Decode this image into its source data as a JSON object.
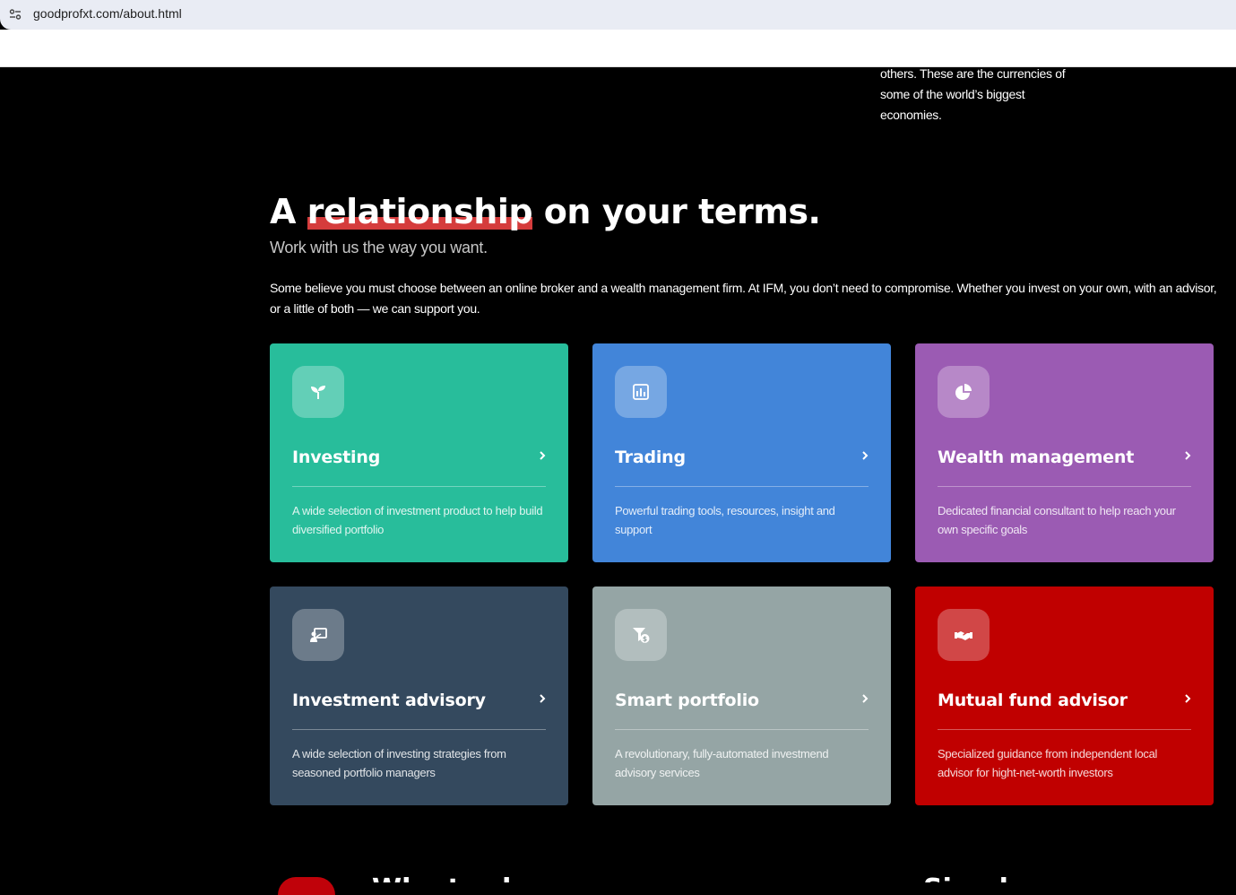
{
  "browser": {
    "url": "goodprofxt.com/about.html"
  },
  "previous_section": {
    "text_lines": [
      "others. These are the currencies of",
      "some of the world’s biggest",
      "economies."
    ]
  },
  "section": {
    "heading_before": "A ",
    "heading_highlight": "relationship",
    "heading_after": " on your terms.",
    "subtitle": "Work with us the way you want.",
    "intro": "Some believe you must choose between an online broker and a wealth management firm. At IFM, you don’t need to compromise. Whether you invest on your own, with an advisor, or a little of both — we can support you.",
    "highlight_color": "#d53c3c"
  },
  "cards": [
    {
      "title": "Investing",
      "desc": "A wide selection of investment product to help build diversified portfolio",
      "icon": "sprout-icon",
      "color": "#28bd9b"
    },
    {
      "title": "Trading",
      "desc": "Powerful trading tools, resources, insight and support",
      "icon": "bar-chart-icon",
      "color": "#4285d9"
    },
    {
      "title": "Wealth management",
      "desc": "Dedicated financial consultant to help reach your own specific goals",
      "icon": "pie-chart-icon",
      "color": "#9b5bb3"
    },
    {
      "title": "Investment advisory",
      "desc": "A wide selection of investing strategies from seasoned portfolio managers",
      "icon": "presentation-icon",
      "color": "#34495e"
    },
    {
      "title": "Smart portfolio",
      "desc": "A revolutionary, fully-automated investmend advisory services",
      "icon": "funnel-dollar-icon",
      "color": "#95a5a5"
    },
    {
      "title": "Mutual fund advisor",
      "desc": "Specialized guidance from independent local advisor for hight-net-worth investors",
      "icon": "handshake-icon",
      "color": "#c00000"
    }
  ],
  "bottom_peek": {
    "left_heading": "Why trade with IFM?",
    "right_heading": "Simple, secure & transparent"
  }
}
